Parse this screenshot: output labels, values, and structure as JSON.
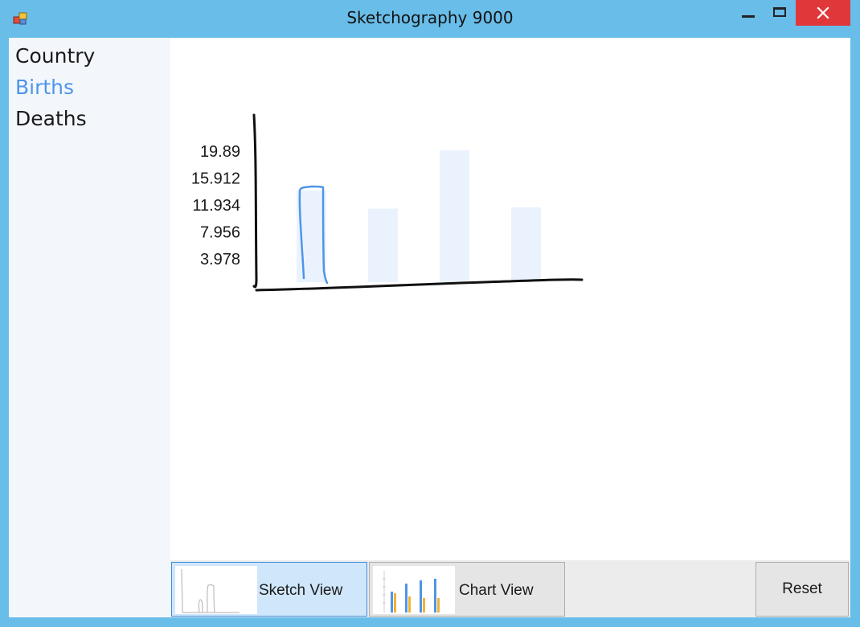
{
  "window": {
    "title": "Sketchography 9000",
    "icon": "app-icon",
    "controls": [
      "minimize-icon",
      "maximize-icon",
      "close-icon"
    ]
  },
  "colors": {
    "titlebar": "#69bde9",
    "sidebar_bg": "#f3f7fc",
    "selected_text": "#4f95e8",
    "close_button": "#e0383a",
    "bar_fill": "#eaf3fd",
    "sketch_stroke": "#4f95e8",
    "axis_stroke": "#111111",
    "active_button_bg": "#cfe6fb"
  },
  "sidebar": {
    "items": [
      {
        "label": "Country",
        "selected": false
      },
      {
        "label": "Births",
        "selected": true
      },
      {
        "label": "Deaths",
        "selected": false
      }
    ]
  },
  "chart_data": {
    "type": "bar",
    "y_ticks": [
      "19.89",
      "15.912",
      "11.934",
      "7.956",
      "3.978"
    ],
    "ylim": [
      0,
      19.89
    ],
    "values": [
      13.8,
      11.1,
      19.89,
      11.3
    ],
    "sketched_bar_index": 0,
    "grid": false
  },
  "toolbar": {
    "sketch_view_label": "Sketch View",
    "chart_view_label": "Chart View",
    "reset_label": "Reset",
    "active_view": "sketch"
  }
}
